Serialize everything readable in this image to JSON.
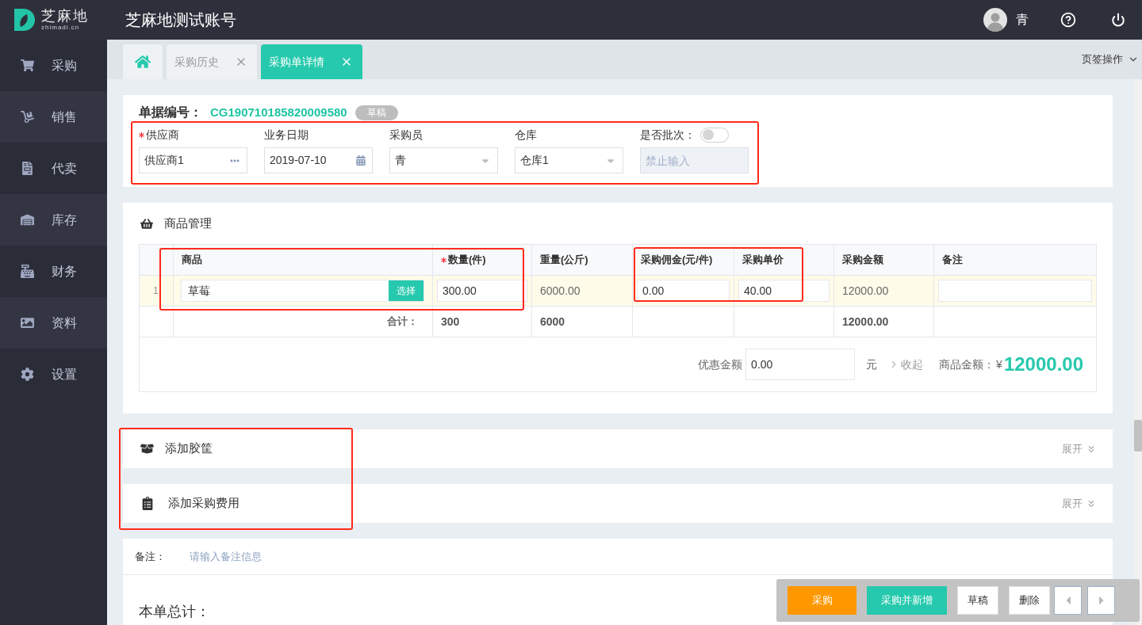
{
  "header": {
    "logo": {
      "title": "芝麻地",
      "subtitle": "zhimadi.cn"
    },
    "account": "芝麻地测试账号",
    "user": "青"
  },
  "sidebar": {
    "items": [
      {
        "label": "采购"
      },
      {
        "label": "销售"
      },
      {
        "label": "代卖"
      },
      {
        "label": "库存"
      },
      {
        "label": "财务"
      },
      {
        "label": "资料"
      },
      {
        "label": "设置"
      }
    ]
  },
  "tabs": [
    {
      "kind": "home",
      "selected": false
    },
    {
      "kind": "page",
      "label": "采购历史",
      "selected": false
    },
    {
      "kind": "page",
      "label": "采购单详情",
      "selected": true
    }
  ],
  "tab_actions": "页签操作",
  "order": {
    "number_label": "单据编号：",
    "number": "CG190710185820009580",
    "status": "草稿",
    "fields": [
      {
        "kind": "picker",
        "label": "供应商",
        "required": true,
        "value": "供应商1"
      },
      {
        "kind": "date",
        "label": "业务日期",
        "required": false,
        "value": "2019-07-10"
      },
      {
        "kind": "select",
        "label": "采购员",
        "required": false,
        "value": "青"
      },
      {
        "kind": "select",
        "label": "仓库",
        "required": false,
        "value": "仓库1"
      },
      {
        "kind": "batch",
        "label": "是否批次：",
        "required": false,
        "on": false,
        "disabled": true,
        "placeholder": "禁止输入"
      }
    ]
  },
  "goods": {
    "title": "商品管理",
    "columns": [
      {
        "label": "商品",
        "required": false
      },
      {
        "label": "数量(件)",
        "required": true,
        "total": "300"
      },
      {
        "label": "重量(公斤)",
        "required": false,
        "total": "6000"
      },
      {
        "label": "采购佣金(元/件)",
        "required": false
      },
      {
        "label": "采购单价",
        "required": false
      },
      {
        "label": "采购金额",
        "required": false,
        "total": "12000.00"
      },
      {
        "label": "备注",
        "required": false
      }
    ],
    "rows": [
      {
        "index": "1",
        "cells": [
          {
            "kind": "product",
            "value": "草莓",
            "button": "选择"
          },
          {
            "kind": "input",
            "value": "300.00"
          },
          {
            "kind": "text",
            "value": "6000.00"
          },
          {
            "kind": "input",
            "value": "0.00"
          },
          {
            "kind": "input",
            "value": "40.00"
          },
          {
            "kind": "text",
            "value": "12000.00"
          },
          {
            "kind": "input"
          }
        ]
      }
    ],
    "total_label": "合计：",
    "footer": {
      "discount_label": "优惠金额",
      "discount_value": "0.00",
      "unit": "元",
      "collapse": "收起",
      "amount_label": "商品金额：",
      "currency": "¥",
      "amount": "12000.00"
    }
  },
  "sections": [
    {
      "kind": "crate",
      "title": "添加胶筐",
      "toggle": "展开"
    },
    {
      "kind": "fee",
      "title": "添加采购费用",
      "toggle": "展开"
    }
  ],
  "remarks": {
    "label": "备注：",
    "placeholder": "请输入备注信息"
  },
  "summary": {
    "label": "本单总计："
  },
  "actions": [
    {
      "kind": "primary",
      "label": "采购"
    },
    {
      "kind": "secondary",
      "label": "采购并新增"
    },
    {
      "kind": "plain",
      "label": "草稿"
    },
    {
      "kind": "plain",
      "label": "删除"
    },
    {
      "kind": "prev"
    },
    {
      "kind": "next"
    }
  ]
}
